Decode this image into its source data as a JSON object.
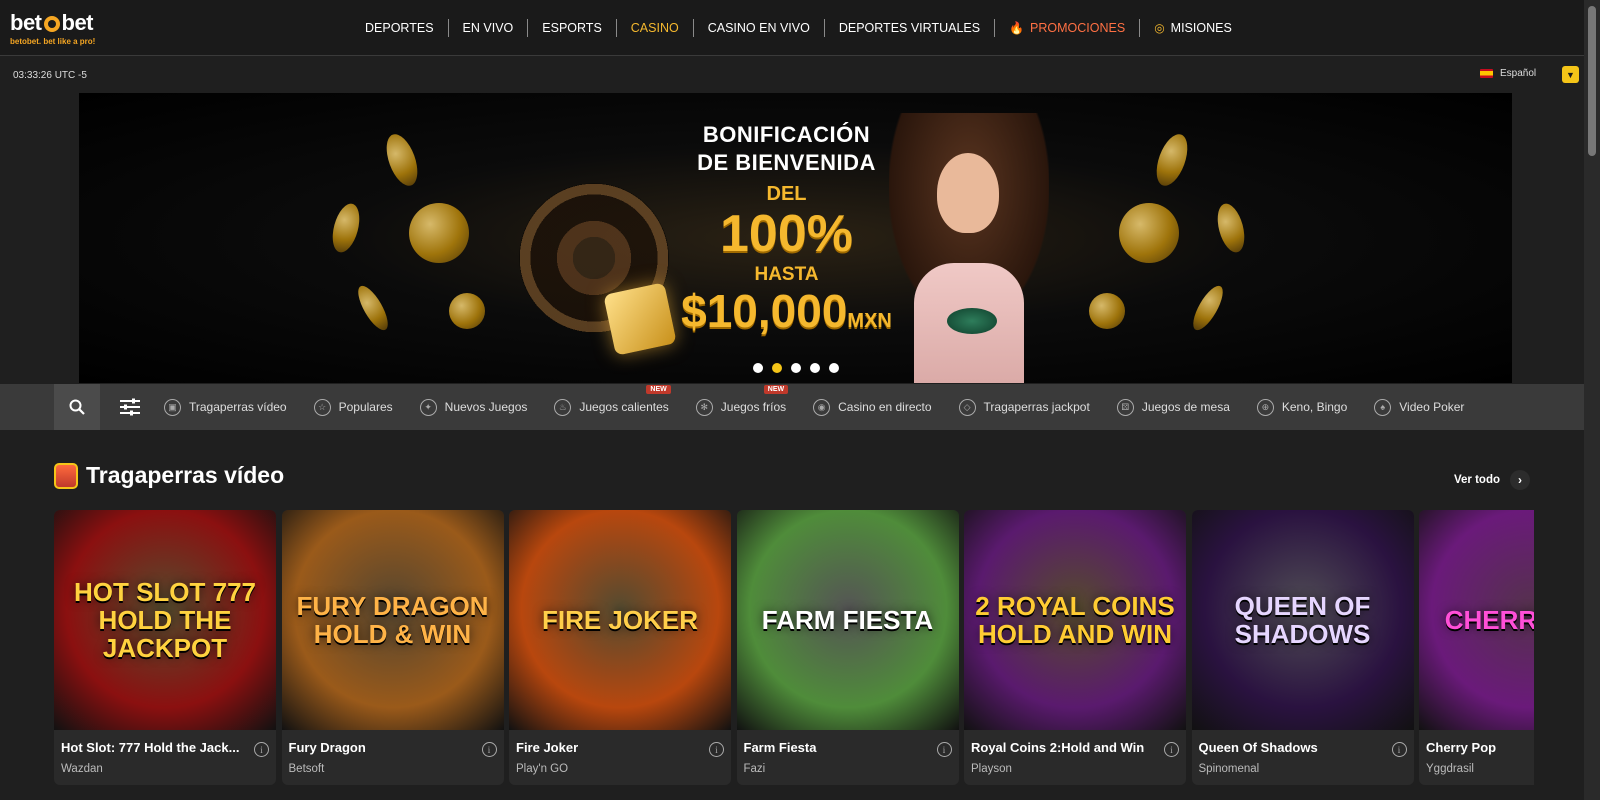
{
  "header": {
    "logo": {
      "left": "bet",
      "right": "bet",
      "tagline": "betobet. bet like a pro!"
    },
    "nav": [
      {
        "label": "DEPORTES",
        "state": "normal"
      },
      {
        "label": "EN VIVO",
        "state": "normal"
      },
      {
        "label": "ESPORTS",
        "state": "normal"
      },
      {
        "label": "CASINO",
        "state": "active"
      },
      {
        "label": "CASINO EN VIVO",
        "state": "normal"
      },
      {
        "label": "DEPORTES VIRTUALES",
        "state": "normal"
      },
      {
        "label": "PROMOCIONES",
        "state": "promo",
        "icon": "fire-icon"
      },
      {
        "label": "MISIONES",
        "state": "normal",
        "icon": "target-icon"
      }
    ],
    "clock": "03:33:26 UTC -5",
    "language": "Español"
  },
  "banner": {
    "line1": "BONIFICACIÓN",
    "line2": "DE BIENVENIDA",
    "line3": "DEL",
    "line4": "100%",
    "line5": "HASTA",
    "amount": "$10,000",
    "currency": "MXN",
    "slide_count": 5,
    "active_slide": 2
  },
  "categories": [
    {
      "label": "Tragaperras vídeo",
      "icon": "slot-icon",
      "badge": ""
    },
    {
      "label": "Populares",
      "icon": "star-icon",
      "badge": ""
    },
    {
      "label": "Nuevos Juegos",
      "icon": "new-icon",
      "badge": ""
    },
    {
      "label": "Juegos calientes",
      "icon": "fire-icon",
      "badge": "NEW"
    },
    {
      "label": "Juegos fríos",
      "icon": "snowflake-icon",
      "badge": "NEW"
    },
    {
      "label": "Casino en directo",
      "icon": "live-icon",
      "badge": ""
    },
    {
      "label": "Tragaperras jackpot",
      "icon": "diamond-icon",
      "badge": ""
    },
    {
      "label": "Juegos de mesa",
      "icon": "dice-icon",
      "badge": ""
    },
    {
      "label": "Keno, Bingo",
      "icon": "gamepad-icon",
      "badge": ""
    },
    {
      "label": "Video Poker",
      "icon": "spade-icon",
      "badge": ""
    }
  ],
  "section": {
    "title": "Tragaperras vídeo",
    "see_all": "Ver todo"
  },
  "games": [
    {
      "name": "Hot Slot: 777 Hold the Jack...",
      "provider": "Wazdan",
      "art": "HOT SLOT 777 HOLD THE JACKPOT",
      "bg": "#8b1010",
      "fg": "#ffd23f"
    },
    {
      "name": "Fury Dragon",
      "provider": "Betsoft",
      "art": "FURY DRAGON HOLD & WIN",
      "bg": "#9a5a1a",
      "fg": "#ffb347"
    },
    {
      "name": "Fire Joker",
      "provider": "Play'n GO",
      "art": "FIRE JOKER",
      "bg": "#b8470e",
      "fg": "#ffcf4a"
    },
    {
      "name": "Farm Fiesta",
      "provider": "Fazi",
      "art": "FARM FIESTA",
      "bg": "#4f8c3a",
      "fg": "#ffffff"
    },
    {
      "name": "Royal Coins 2:Hold and Win",
      "provider": "Playson",
      "art": "2 ROYAL COINS HOLD AND WIN",
      "bg": "#5a1a6e",
      "fg": "#ffcc33"
    },
    {
      "name": "Queen Of Shadows",
      "provider": "Spinomenal",
      "art": "QUEEN OF SHADOWS",
      "bg": "#2a1240",
      "fg": "#e6d6ff"
    },
    {
      "name": "Cherry Pop",
      "provider": "Yggdrasil",
      "art": "CHERRY POP",
      "bg": "#6a1a7a",
      "fg": "#ff4fd8"
    }
  ]
}
